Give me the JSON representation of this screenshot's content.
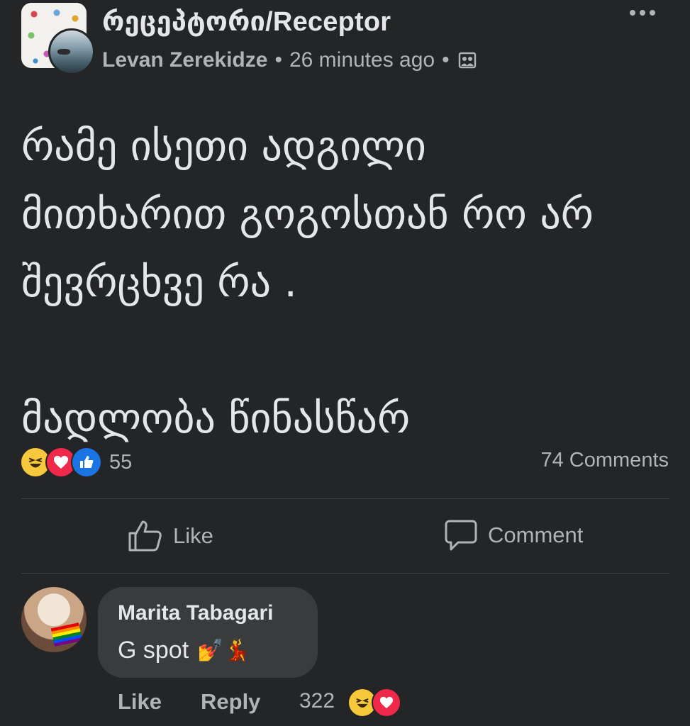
{
  "post": {
    "group_name": "რეცეპტორი/Receptor",
    "author": "Levan Zerekidze",
    "separator": "•",
    "time": "26 minutes ago",
    "privacy_icon": "group-members-icon",
    "lines": [
      "რამე ისეთი ადგილი",
      "მითხარით გოგოსთან რო არ",
      "შევრცხვე რა .",
      "მადლობა წინასწარ"
    ],
    "reaction_icons": [
      "haha",
      "love",
      "like"
    ],
    "reaction_count": "55",
    "comments_count": "74 Comments",
    "actions": {
      "like": "Like",
      "comment": "Comment"
    }
  },
  "comment": {
    "name": "Marita Tabagari",
    "text": "G spot",
    "emoji": "💅💃",
    "like": "Like",
    "reply": "Reply",
    "reaction_count": "322",
    "reaction_icons": [
      "haha",
      "love"
    ]
  },
  "colors": {
    "background": "#242526",
    "text": "#e4e6eb",
    "muted": "#b0b3b8",
    "bubble": "#3a3b3c",
    "haha": "#f7c83b",
    "love": "#f02849",
    "like": "#1b74e4"
  }
}
